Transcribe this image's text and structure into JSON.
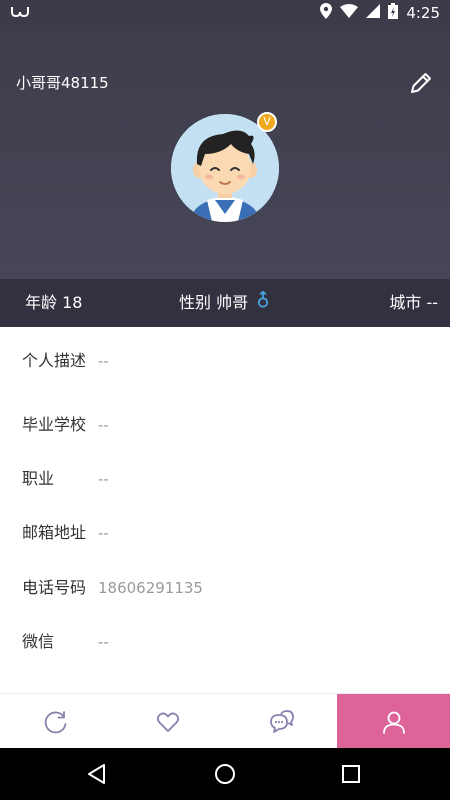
{
  "status_bar": {
    "time": "4:25",
    "icons": [
      "app-notification-icon",
      "location-icon",
      "wifi-icon",
      "signal-icon",
      "battery-charging-icon"
    ]
  },
  "profile": {
    "username": "小哥哥48115",
    "vip_badge": "V",
    "edit_icon": "pencil-icon"
  },
  "stats": {
    "age": "年龄 18",
    "gender": "性别 帅哥",
    "gender_icon": "male-icon",
    "city": "城市 --"
  },
  "details": [
    {
      "label": "个人描述",
      "value": "--"
    },
    {
      "label": "毕业学校",
      "value": "--"
    },
    {
      "label": "职业",
      "value": "--"
    },
    {
      "label": "邮箱地址",
      "value": "--"
    },
    {
      "label": "电话号码",
      "value": "18606291135"
    },
    {
      "label": "微信",
      "value": "--"
    }
  ],
  "tabs": [
    {
      "icon": "refresh-circle-icon",
      "active": false
    },
    {
      "icon": "heart-icon",
      "active": false
    },
    {
      "icon": "chat-bubbles-icon",
      "active": false
    },
    {
      "icon": "user-icon",
      "active": true
    }
  ],
  "colors": {
    "header_bg": "#3f3f4d",
    "stats_bg": "#31313f",
    "accent_pink": "#dc6498",
    "tab_icon": "#8a80b0",
    "vip_gold": "#f0a81f",
    "male_blue": "#4aa3df"
  },
  "nav": [
    "back-icon",
    "home-icon",
    "recents-icon"
  ]
}
